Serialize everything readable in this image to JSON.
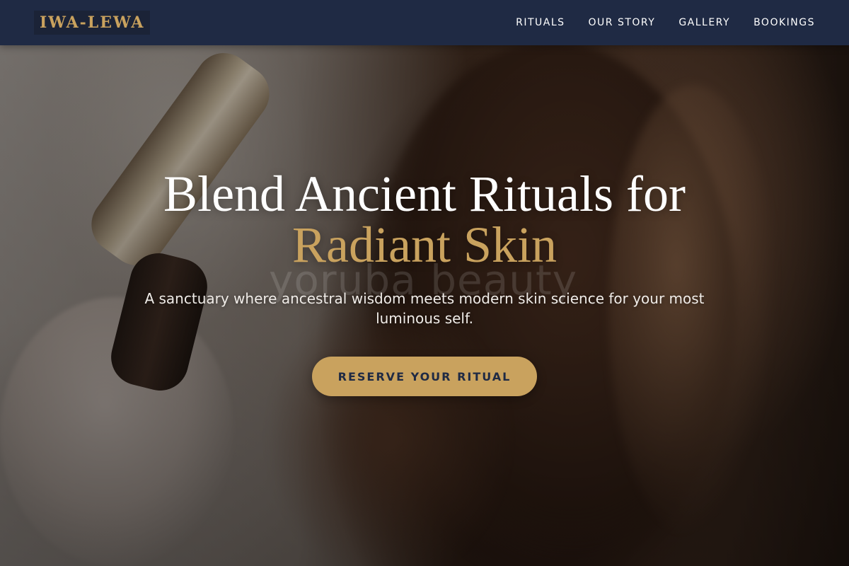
{
  "nav": {
    "logo": "IWA-LEWA",
    "links": [
      {
        "label": "RITUALS"
      },
      {
        "label": "OUR STORY"
      },
      {
        "label": "GALLERY"
      },
      {
        "label": "BOOKINGS"
      }
    ]
  },
  "hero": {
    "headline_line1": "Blend Ancient Rituals for",
    "headline_line2": "Radiant Skin",
    "watermark": "yoruba beauty",
    "subtitle": "A sanctuary where ancestral wisdom meets modern skin science for your most luminous self.",
    "cta_label": "RESERVE YOUR RITUAL"
  },
  "colors": {
    "nav_bg": "#1f2a44",
    "accent_gold": "#c9a25e",
    "text_light": "#ffffff"
  }
}
